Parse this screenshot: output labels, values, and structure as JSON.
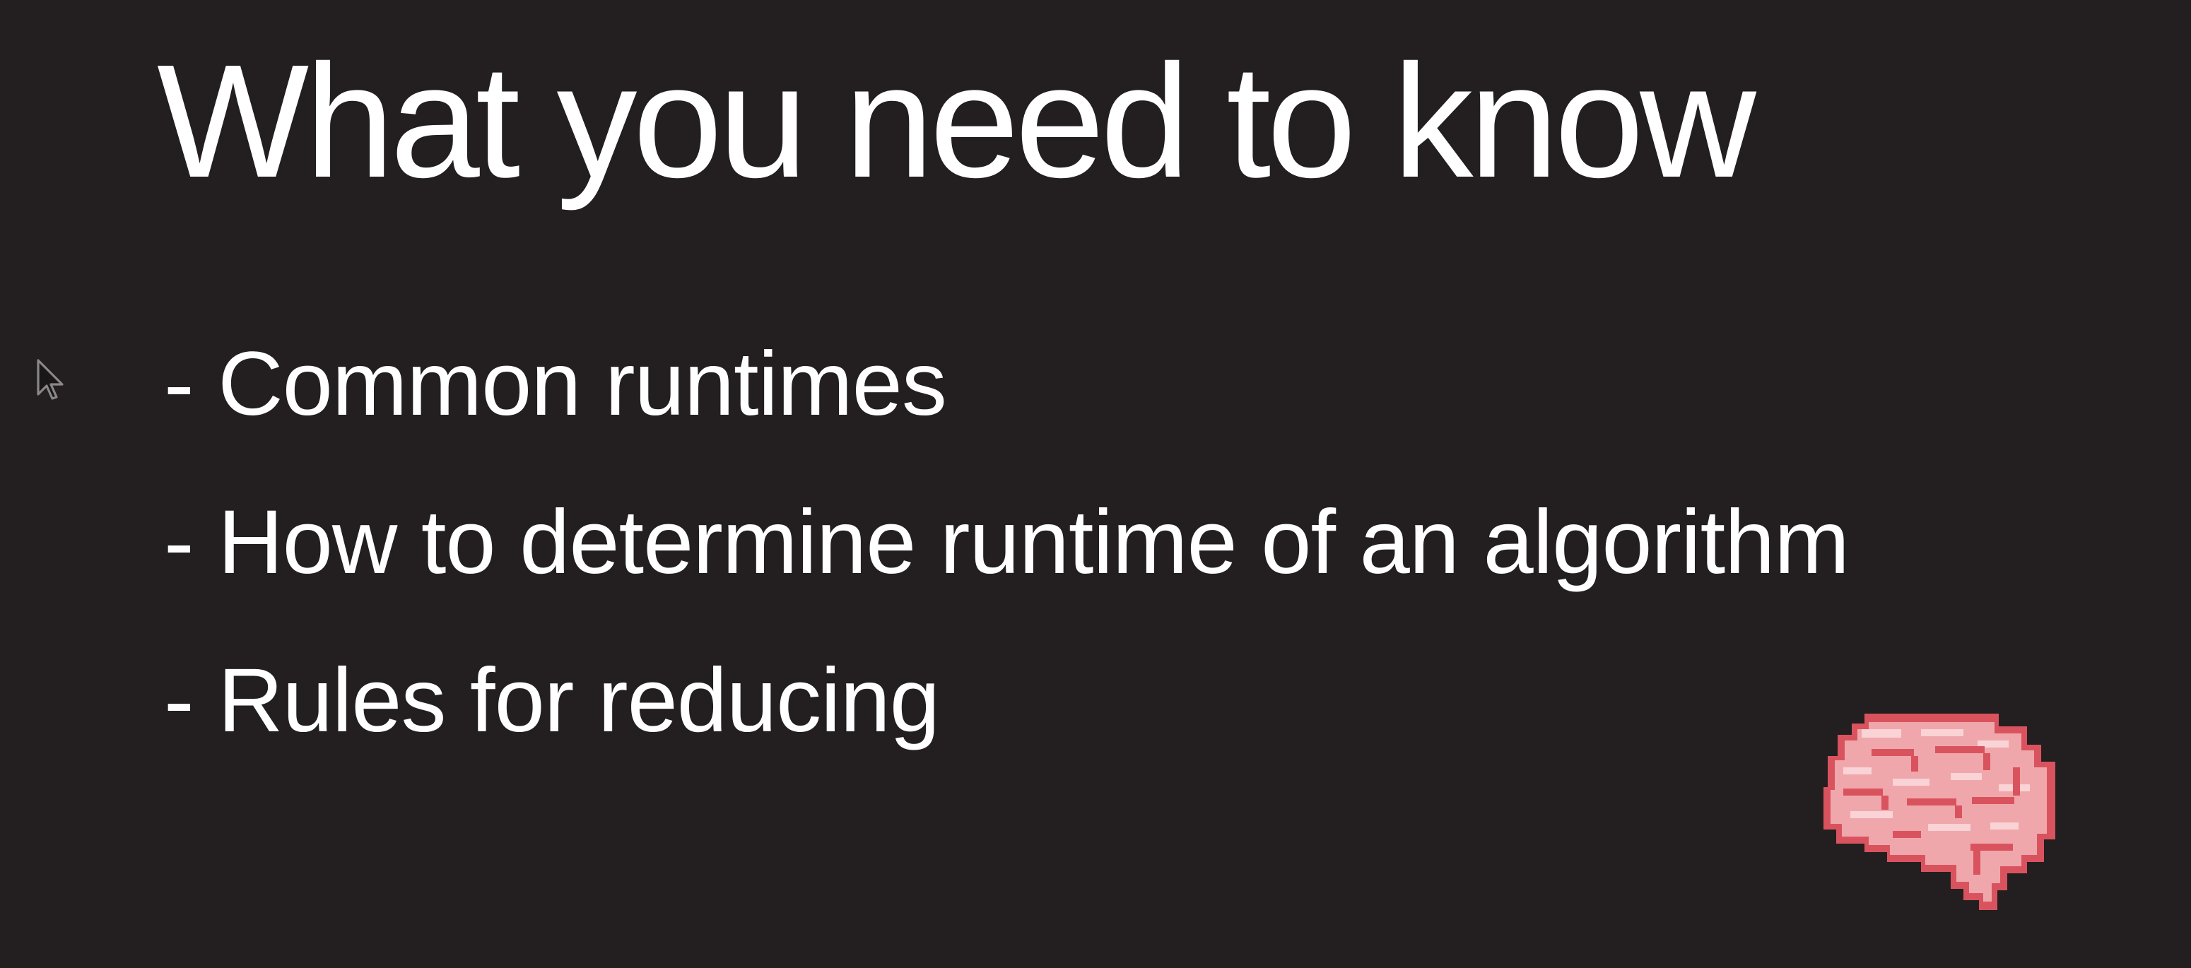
{
  "slide": {
    "title": "What you need to know",
    "bullets": [
      "- Common runtimes",
      "- How to determine runtime of an algorithm",
      "- Rules for reducing"
    ]
  },
  "icons": {
    "cursor": "mouse-pointer-icon",
    "brain": "pixel-brain-icon"
  },
  "colors": {
    "background": "#231f20",
    "text": "#ffffff",
    "brain_pink": "#f0a7ac",
    "brain_outline": "#d9535e"
  }
}
